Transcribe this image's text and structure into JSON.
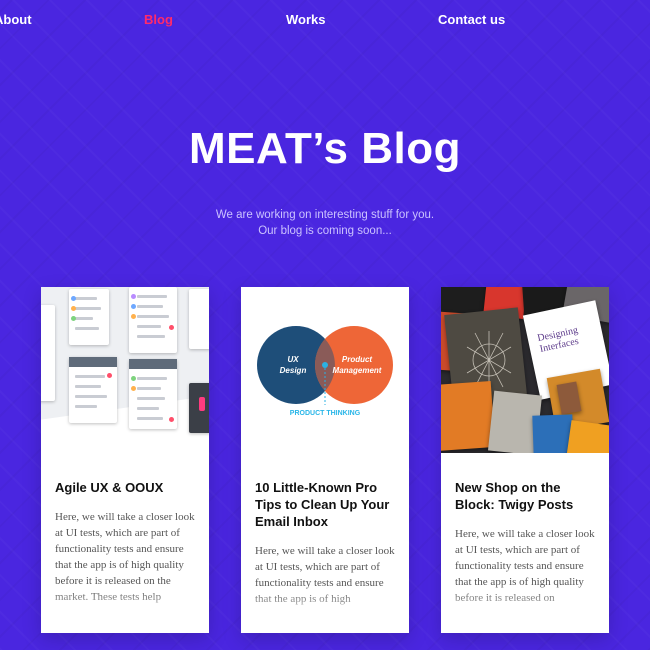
{
  "nav": {
    "items": [
      {
        "label": "About",
        "active": false
      },
      {
        "label": "Blog",
        "active": true
      },
      {
        "label": "Works",
        "active": false
      },
      {
        "label": "Contact us",
        "active": false
      }
    ]
  },
  "hero": {
    "title": "MEAT’s Blog",
    "subtitle_line1": "We are working on interesting stuff for you.",
    "subtitle_line2": "Our blog is coming soon..."
  },
  "cards": [
    {
      "title": "Agile UX & OOUX",
      "excerpt": "Here, we will take a closer look at UI tests, which are part of functionality tests and ensure that the app is of high quality before it is released on the market. These tests help",
      "thumbnail_icon": "ui-mockup-image"
    },
    {
      "title": "10 Little-Known Pro Tips to Clean Up Your Email Inbox",
      "excerpt": "Here, we will take a closer look at UI tests, which are part of functionality tests and ensure that the app is of high",
      "thumbnail": {
        "circle_left": "UX Design",
        "circle_right": "Product Management",
        "caption": "PRODUCT THINKING"
      }
    },
    {
      "title": "New Shop on the Block: Twigy Posts",
      "excerpt": "Here, we will take a closer look at UI tests, which are part of functionality tests and ensure that the app is of high quality before it is released on",
      "thumbnail_icon": "books-photo"
    }
  ],
  "colors": {
    "background": "#4a26e0",
    "active_nav": "#ff2a6a",
    "venn_left": "#1e4e79",
    "venn_right": "#ee6637",
    "caption": "#29b6e8"
  }
}
